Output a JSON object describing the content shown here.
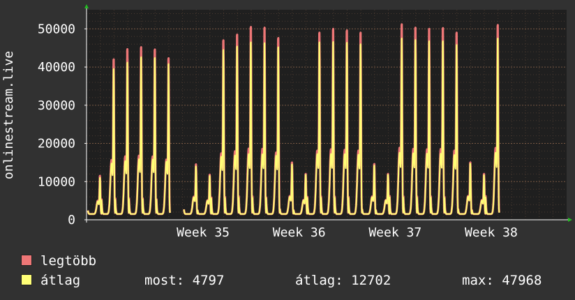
{
  "colors": {
    "background": "#313131",
    "plot_background": "#1f1f1f",
    "grid": "#5a4a3a",
    "max_series": "#ee7777",
    "avg_series": "#ffff77",
    "axis_arrow": "#22bb22"
  },
  "chart_data": {
    "type": "area",
    "title": "",
    "xlabel": "",
    "ylabel": "onlinestream.live",
    "ylim": [
      0,
      55000
    ],
    "xlim": [
      0,
      35
    ],
    "x_unit": "days",
    "yticks": [
      0,
      10000,
      20000,
      30000,
      40000,
      50000
    ],
    "ytick_labels": [
      "0",
      "10000",
      "20000",
      "30000",
      "40000",
      "50000"
    ],
    "xticks": [
      8.5,
      15.5,
      22.5,
      29.5
    ],
    "xtick_labels": [
      "Week 35",
      "Week 36",
      "Week 37",
      "Week 38"
    ],
    "grid": true,
    "series": [
      {
        "name": "legtöbb",
        "daily_peaks": [
          11500,
          42000,
          44700,
          45200,
          44600,
          42300,
          null,
          14500,
          11800,
          47000,
          48500,
          50500,
          50300,
          47600,
          15000,
          12000,
          49000,
          50000,
          49600,
          49000,
          14600,
          12000,
          51200,
          50300,
          50000,
          50200,
          49000,
          15000,
          12000,
          51000
        ]
      },
      {
        "name": "átlag",
        "daily_peaks": [
          11000,
          39500,
          41200,
          42600,
          42400,
          40800,
          null,
          14000,
          11500,
          44500,
          45400,
          46500,
          46300,
          45200,
          14500,
          11800,
          46500,
          46600,
          46400,
          46000,
          14200,
          11800,
          47500,
          47100,
          46800,
          46800,
          45800,
          14700,
          11700,
          47500
        ]
      }
    ],
    "gap_days": [
      6
    ],
    "legend_placement": "bottom-left",
    "legend": [
      {
        "label": "legtöbb",
        "color": "#ee7777"
      },
      {
        "label": "átlag",
        "color": "#ffff77"
      }
    ]
  },
  "stats": {
    "now": "most: 4797",
    "avg": "átlag: 12702",
    "max": "max: 47968"
  }
}
